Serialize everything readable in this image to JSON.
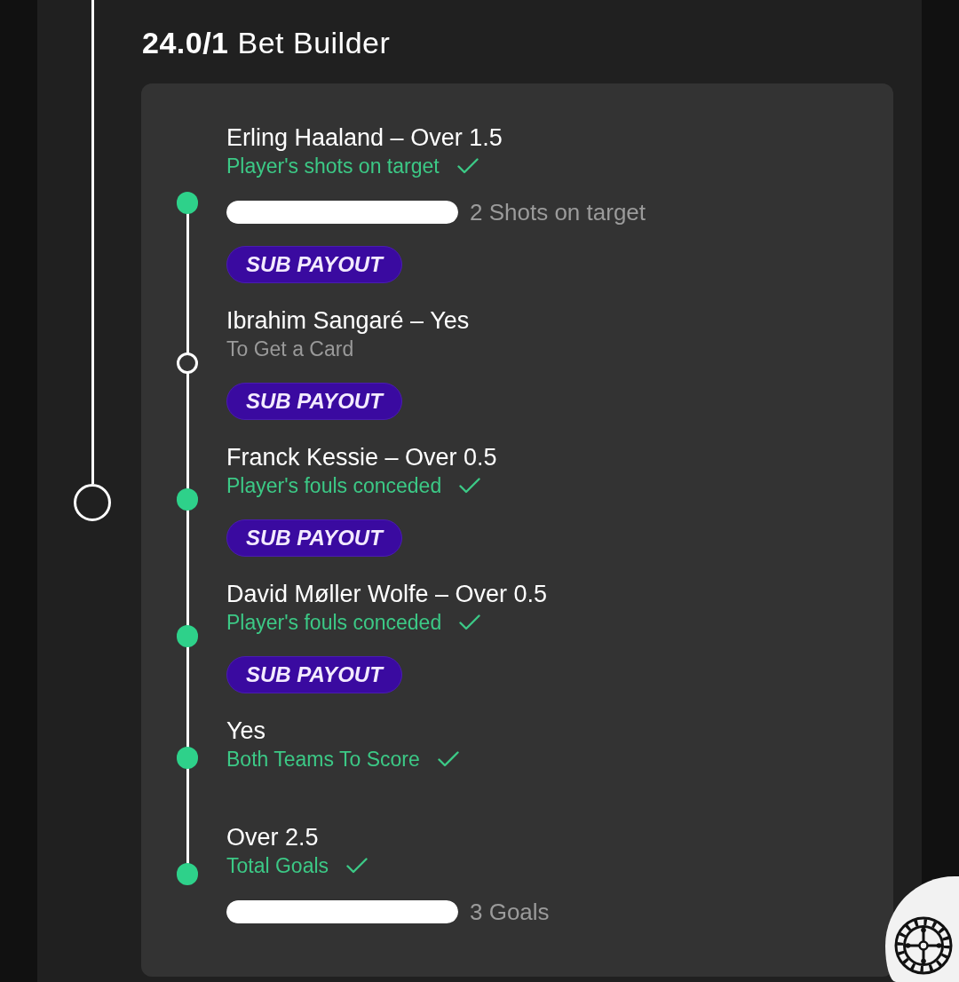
{
  "heading": "**24.0/1** Bet Builder",
  "legs": [
    {
      "selection": "Erling Haaland – Over 1.5",
      "market": "Player's shots on target",
      "won": true,
      "progress": {
        "level": 1,
        "reading": "2 Shots on target"
      },
      "badge": "SUB PAYOUT"
    },
    {
      "selection": "Ibrahim Sangaré – Yes",
      "market": "To Get a Card",
      "won": false,
      "badge": "SUB PAYOUT"
    },
    {
      "selection": "Franck Kessie – Over 0.5",
      "market": "Player's fouls conceded",
      "won": true,
      "badge": "SUB PAYOUT"
    },
    {
      "selection": "David Møller Wolfe – Over 0.5",
      "market": "Player's fouls conceded",
      "won": true,
      "badge": "SUB PAYOUT"
    },
    {
      "selection": "Yes",
      "market": "Both Teams To Score",
      "won": true
    },
    {
      "selection": "Over 2.5",
      "market": "Total Goals",
      "won": true,
      "progress": {
        "level": 1,
        "reading": "3 Goals"
      }
    }
  ]
}
